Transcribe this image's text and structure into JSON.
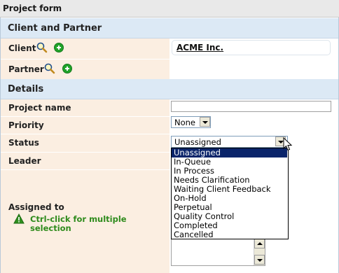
{
  "header": {
    "title": "Project form"
  },
  "sections": {
    "client_partner": "Client and Partner",
    "details": "Details"
  },
  "client": {
    "label": "Client",
    "value": "ACME Inc."
  },
  "partner": {
    "label": "Partner"
  },
  "fields": {
    "project_name": {
      "label": "Project name",
      "value": ""
    },
    "priority": {
      "label": "Priority",
      "value": "None"
    },
    "status": {
      "label": "Status",
      "value": "Unassigned"
    },
    "leader": {
      "label": "Leader"
    },
    "assigned_to": {
      "label": "Assigned to",
      "hint": "Ctrl-click for multiple selection"
    }
  },
  "status_options": [
    "Unassigned",
    "In-Queue",
    "In Process",
    "Needs Clarification",
    "Waiting Client Feedback",
    "On-Hold",
    "Perpetual",
    "Quality Control",
    "Completed",
    "Cancelled"
  ],
  "status_selected_index": 0,
  "colors": {
    "section_bg": "#dce9f5",
    "label_bg": "#fbeee1",
    "selection_bg": "#0a246a",
    "hint_green": "#2e8b1c",
    "add_icon_green": "#21a32a"
  },
  "icons": {
    "search": "magnifier-icon",
    "add": "plus-circle-icon",
    "warning": "warning-icon",
    "cursor": "mouse-pointer"
  }
}
